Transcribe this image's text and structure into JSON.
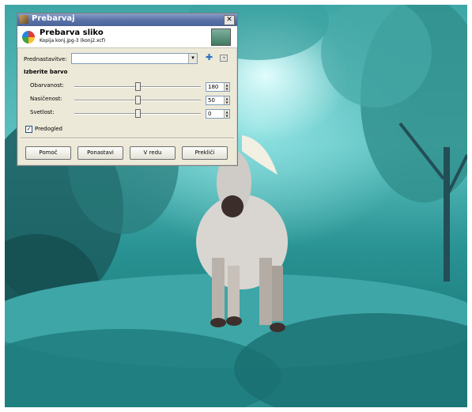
{
  "dialog": {
    "title": "Prebarvaj",
    "close_glyph": "✕",
    "header_title": "Prebarva sliko",
    "header_subtitle": "Kopija konj.jpg-3 (konj2.xcf)"
  },
  "presets": {
    "label": "Prednastavitve:",
    "value": "",
    "add_glyph": "✚",
    "menu_glyph": "◂"
  },
  "section": {
    "title": "Izberite barvo"
  },
  "sliders": [
    {
      "label": "Obarvanost:",
      "value": "180",
      "fraction": 0.5
    },
    {
      "label": "Nasičenost:",
      "value": "50",
      "fraction": 0.5
    },
    {
      "label": "Svetlost:",
      "value": "0",
      "fraction": 0.5
    }
  ],
  "preview": {
    "label": "Predogled",
    "checked": true,
    "check_glyph": "✓"
  },
  "buttons": {
    "help": "Pomoč",
    "reset": "Ponastavi",
    "ok": "V redu",
    "cancel": "Prekliči"
  },
  "icons": {
    "dropdown": "▾",
    "spin_up": "▲",
    "spin_down": "▼"
  },
  "colors": {
    "titlebar": "#5b74a8",
    "dialog_bg": "#ece9d8",
    "photo_teal": "#3ea6a6"
  }
}
